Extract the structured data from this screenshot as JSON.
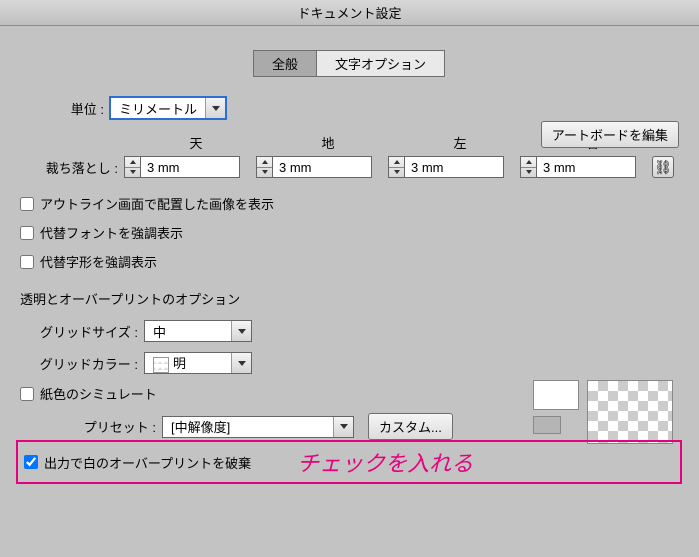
{
  "window": {
    "title": "ドキュメント設定"
  },
  "tabs": {
    "general": "全般",
    "type": "文字オプション"
  },
  "unit": {
    "label": "単位 :",
    "value": "ミリメートル"
  },
  "editArtboard": "アートボードを編集",
  "bleed": {
    "label": "裁ち落とし :",
    "headers": {
      "top": "天",
      "bottom": "地",
      "left": "左",
      "right": "右"
    },
    "values": {
      "top": "3 mm",
      "bottom": "3 mm",
      "left": "3 mm",
      "right": "3 mm"
    }
  },
  "checks": {
    "outlineImages": "アウトライン画面で配置した画像を表示",
    "highlightSubstFonts": "代替フォントを強調表示",
    "highlightSubstGlyphs": "代替字形を強調表示"
  },
  "transparency": {
    "section": "透明とオーバープリントのオプション",
    "gridSize": {
      "label": "グリッドサイズ :",
      "value": "中"
    },
    "gridColor": {
      "label": "グリッドカラー :",
      "value": "明"
    },
    "simulatePaper": "紙色のシミュレート",
    "preset": {
      "label": "プリセット :",
      "value": "[中解像度]",
      "custom": "カスタム..."
    },
    "discardWhiteOverprint": "出力で白のオーバープリントを破棄"
  },
  "annotation": "チェックを入れる"
}
